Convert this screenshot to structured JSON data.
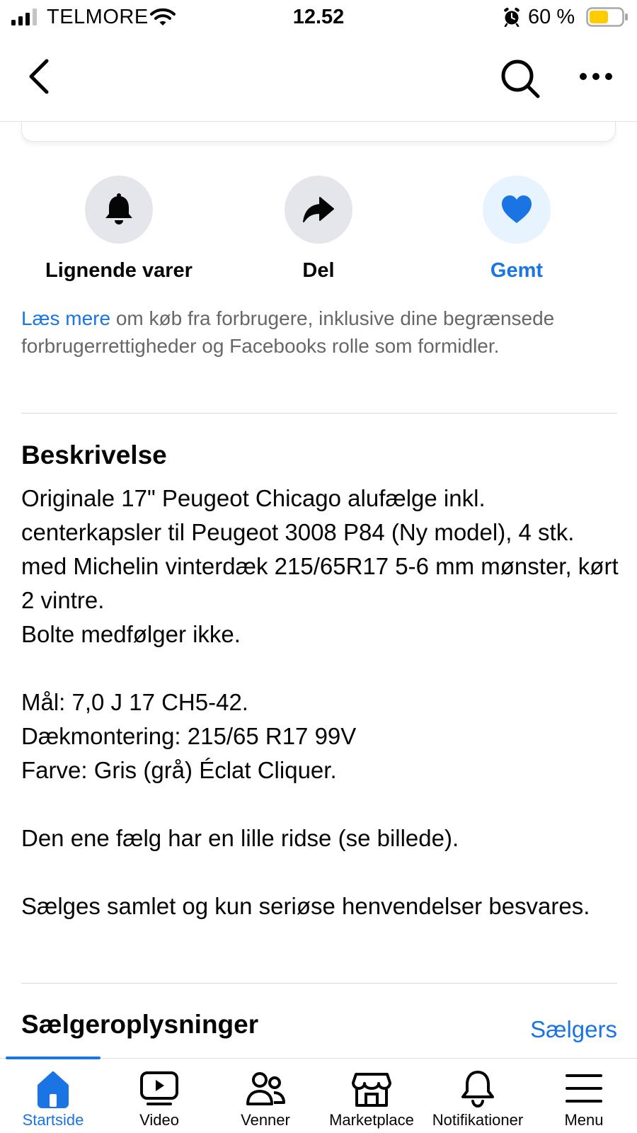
{
  "status_bar": {
    "carrier": "TELMORE",
    "time": "12.52",
    "battery_percent": "60 %",
    "battery_level": 0.6,
    "battery_color": "#ffcc00"
  },
  "nav": {
    "back_icon": "chevron-left-icon",
    "search_icon": "search-icon",
    "more_icon": "more-icon"
  },
  "actions": [
    {
      "label": "Lignende varer",
      "icon": "bell-icon"
    },
    {
      "label": "Del",
      "icon": "share-icon"
    },
    {
      "label": "Gemt",
      "icon": "heart-icon",
      "active": true
    }
  ],
  "consumer_info": {
    "link_text": "Læs mere",
    "text": " om køb fra forbrugere, inklusive dine begrænsede forbrugerrettigheder og Facebooks rolle som formidler."
  },
  "description": {
    "title": "Beskrivelse",
    "body": "Originale 17\" Peugeot Chicago alufælge inkl. centerkapsler til Peugeot 3008 P84 (Ny model), 4 stk. med Michelin vinterdæk 215/65R17 5-6 mm mønster, kørt 2 vintre.\nBolte medfølger ikke.\n\nMål: 7,0 J 17 CH5-42.\nDækmontering: 215/65 R17 99V\nFarve: Gris (grå) Éclat Cliquer.\n\nDen ene fælg har en lille ridse (se billede).\n\nSælges samlet og kun seriøse henvendelser besvares."
  },
  "seller": {
    "title": "Sælgeroplysninger",
    "link": "Sælgers oplysninger"
  },
  "tabs": [
    {
      "label": "Startside",
      "icon": "home-icon",
      "active": true
    },
    {
      "label": "Video",
      "icon": "video-icon"
    },
    {
      "label": "Venner",
      "icon": "friends-icon"
    },
    {
      "label": "Marketplace",
      "icon": "marketplace-icon"
    },
    {
      "label": "Notifikationer",
      "icon": "notification-bell-icon"
    },
    {
      "label": "Menu",
      "icon": "menu-icon"
    }
  ],
  "colors": {
    "accent": "#1b74e4",
    "secondary_text": "#65676b",
    "icon_bg": "#e4e6eb",
    "saved_bg": "#e7f3ff"
  }
}
